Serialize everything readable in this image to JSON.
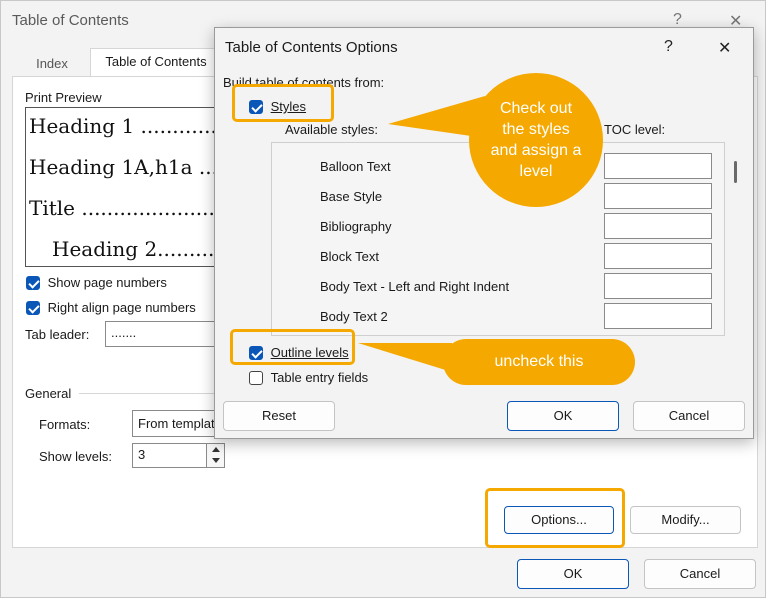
{
  "outer": {
    "title": "Table of Contents",
    "help_glyph": "?",
    "close_glyph": "✕",
    "tabs": [
      "Index",
      "Table of Contents"
    ],
    "print_preview_label": "Print Preview",
    "preview_lines": [
      "Heading 1 ..............",
      "Heading 1A,h1a ........",
      "Title ...........................",
      "Heading 2..............."
    ],
    "show_page_numbers": "Show page numbers",
    "right_align": "Right align page numbers",
    "tab_leader_label": "Tab leader:",
    "tab_leader_value": ".......",
    "general_label": "General",
    "formats_label": "Formats:",
    "formats_value": "From template",
    "show_levels_label": "Show levels:",
    "show_levels_value": "3",
    "options_button": "Options...",
    "modify_button": "Modify...",
    "ok_button": "OK",
    "cancel_button": "Cancel"
  },
  "options_dialog": {
    "title": "Table of Contents Options",
    "help_glyph": "?",
    "close_glyph": "✕",
    "build_label": "Build table of contents from:",
    "styles_label": "Styles",
    "available_styles_label": "Available styles:",
    "toc_level_label": "TOC level:",
    "styles": [
      "Balloon Text",
      "Base Style",
      "Bibliography",
      "Block Text",
      "Body Text - Left and Right Indent",
      "Body Text 2"
    ],
    "outline_levels_label": "Outline levels",
    "table_entry_label": "Table entry fields",
    "reset_button": "Reset",
    "ok_button": "OK",
    "cancel_button": "Cancel"
  },
  "callouts": {
    "styles": "Check out the styles and assign a level",
    "outline": "uncheck this"
  },
  "colors": {
    "accent_orange": "#f5a800",
    "checkbox_blue": "#0b57b7"
  }
}
